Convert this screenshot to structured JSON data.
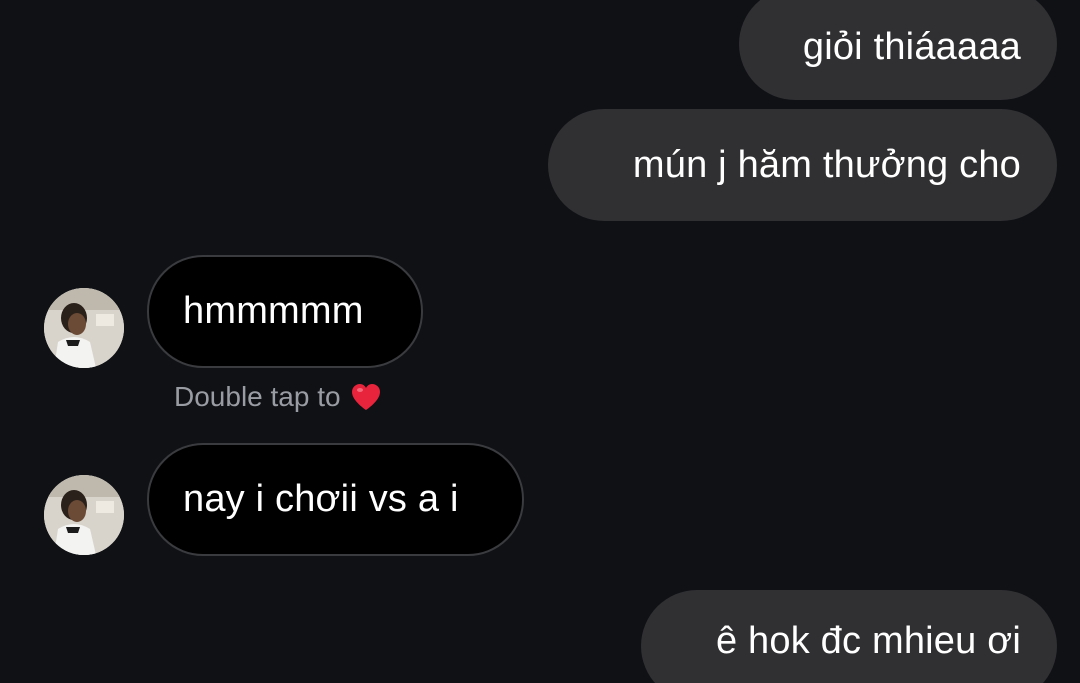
{
  "messages": [
    {
      "from": "me",
      "text": "giỏi thiáaaaa"
    },
    {
      "from": "me",
      "text": "mún j hăm thưởng cho"
    },
    {
      "from": "them",
      "text": "hmmmmm"
    },
    {
      "from": "them",
      "text": "nay i chơii vs a i"
    },
    {
      "from": "me",
      "text": "ê hok đc mhieu ơi"
    }
  ],
  "reaction_hint": {
    "text": "Double tap to",
    "icon": "heart-icon"
  },
  "colors": {
    "background": "#0f1115",
    "outgoing_bubble": "#303033",
    "incoming_bubble": "#000000",
    "incoming_border": "#3a3b3f",
    "hint_text": "#9a9ca3",
    "heart": "#e8243c"
  }
}
